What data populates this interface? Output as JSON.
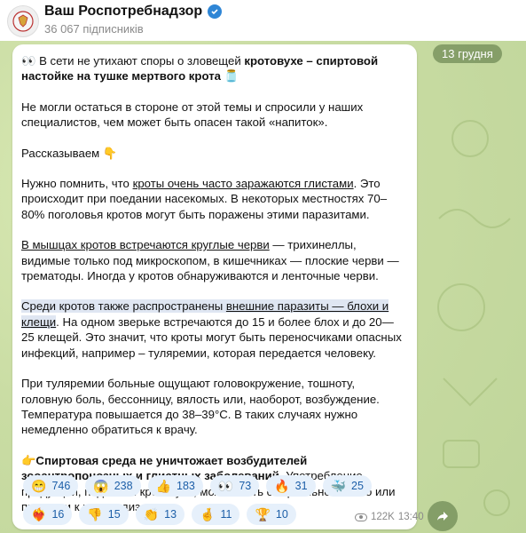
{
  "channel": {
    "title": "Ваш Роспотребнадзор",
    "subscribers": "36 067 підписників"
  },
  "date_chip": "13 грудня",
  "message": {
    "p1_emoji": "👀",
    "p1_text": "В сети не утихают споры о зловещей ",
    "p1_bold": "кротовухе – спиртовой настойке на тушке мертвого крота",
    "p1_end_emoji": "🫙",
    "p2": "Не могли остаться в стороне от этой темы и спросили у наших специалистов, чем может быть опасен такой «напиток».",
    "p3": "Рассказываем",
    "p3_emoji": "👇",
    "p4_link": "кроты очень часто заражаются глистами",
    "p4_pre": "Нужно помнить, что ",
    "p4_post": ". Это происходит при поедании насекомых. В некоторых местностях 70–80% поголовья кротов могут быть поражены этими паразитами.",
    "p5_link": "В мышцах кротов встречаются круглые черви",
    "p5_post": " — трихинеллы, видимые только под микроскопом, в кишечниках — плоские черви — трематоды. Иногда у кротов обнаруживаются и ленточные черви.",
    "p6_pre": "Среди кротов также распространены ",
    "p6_link": "внешние паразиты — блохи и клещи",
    "p6_post": ". На одном зверьке встречаются до 15 и более блох и до 20—25 клещей. Это значит, что кроты могут быть переносчиками опасных инфекций, например – туляремии, которая передается человеку.",
    "p7": "При туляремии больные ощущают головокружение, тошноту, головную боль, бессонницу, вялость или, наоборот, возбуждение. Температура повышается до 38–39°C. В таких случаях нужно немедленно обратиться к врачу.",
    "p8_emoji": "👉",
    "p8_bold": "Спиртовая среда не уничтожает возбудителей зооантропонозных и глистных заболеваний.",
    "p8_post": " Употребление продукции, подобной кротовухе, может быть смертельно опасно или привести к инвалидизации."
  },
  "reactions": [
    {
      "emoji": "😁",
      "count": "746"
    },
    {
      "emoji": "😱",
      "count": "238"
    },
    {
      "emoji": "👍",
      "count": "183"
    },
    {
      "emoji": "👀",
      "count": "73"
    },
    {
      "emoji": "🔥",
      "count": "31"
    },
    {
      "emoji": "🐳",
      "count": "25"
    },
    {
      "emoji": "❤️‍🔥",
      "count": "16"
    },
    {
      "emoji": "👎",
      "count": "15"
    },
    {
      "emoji": "👏",
      "count": "13"
    },
    {
      "emoji": "🤞",
      "count": "11"
    },
    {
      "emoji": "🏆",
      "count": "10"
    }
  ],
  "meta": {
    "views": "122K",
    "time": "13:40"
  },
  "colors": {
    "background": "#c9dca3",
    "reaction_bg": "#e6f0fb",
    "reaction_text": "#1d5fa8",
    "verified": "#2f86d6"
  }
}
